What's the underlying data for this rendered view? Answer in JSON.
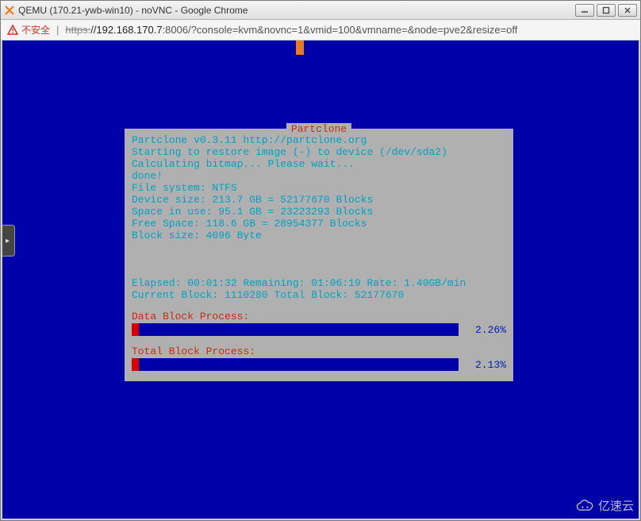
{
  "window": {
    "title": "QEMU (170.21-ywb-win10) - noVNC - Google Chrome"
  },
  "urlbar": {
    "security_label": "不安全",
    "protocol_strike": "https:",
    "host": "//192.168.170.7",
    "rest": ":8006/?console=kvm&novnc=1&vmid=100&vmname=&node=pve2&resize=off"
  },
  "sidebar_tab_glyph": "▸",
  "partclone": {
    "title": "Partclone",
    "version_line": "Partclone v0.3.11 http://partclone.org",
    "start_line_a": "Starting to restore image (-) to device ",
    "start_line_b": "(/dev/sda2)",
    "calc_line": "Calculating bitmap... Please wait...",
    "done_line": "done!",
    "fs_label": "File system:  ",
    "fs_value": "NTFS",
    "dev_label": "Device size:  ",
    "dev_value": "213.7 GB = 52177670 Blocks",
    "use_label": "Space in use:  ",
    "use_value": "95.1 GB = 23223293 Blocks",
    "free_label": "Free Space:   ",
    "free_value": "118.6 GB = 28954377 Blocks",
    "blk_label": "Block size:   ",
    "blk_value": "4096 Byte",
    "elapsed_label": "Elapsed: ",
    "elapsed_value": "00:01:32",
    "remaining_label": " Remaining: ",
    "remaining_value": "01:06:19",
    "rate_label": "   Rate:   ",
    "rate_value": "1.40GB/min",
    "curblk_label": "Current Block: ",
    "curblk_value": "1110280",
    "totblk_label": "  Total Block: ",
    "totblk_value": "52177670",
    "data_label": "Data Block Process:",
    "data_pct": "2.26%",
    "data_fill_pct": "2.26",
    "total_label": "Total Block Process:",
    "total_pct": "2.13%",
    "total_fill_pct": "2.13"
  },
  "watermark": {
    "text": "亿速云"
  }
}
